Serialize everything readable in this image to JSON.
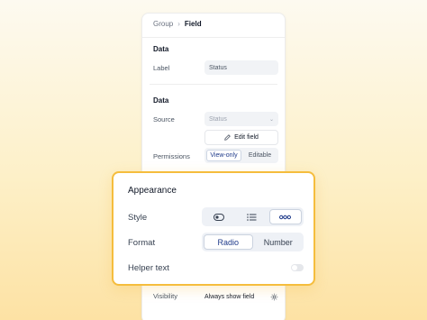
{
  "breadcrumb": {
    "parent": "Group",
    "separator": "›",
    "current": "Field"
  },
  "data_section_1": {
    "title": "Data",
    "label_label": "Label",
    "label_value": "Status"
  },
  "data_section_2": {
    "title": "Data",
    "source_label": "Source",
    "source_value": "Status",
    "edit_button": "Edit field",
    "permissions_label": "Permissions",
    "permissions_options": [
      "View-only",
      "Editable"
    ],
    "permissions_selected": "View-only"
  },
  "visibility": {
    "label": "Visibility",
    "value": "Always show field"
  },
  "appearance": {
    "title": "Appearance",
    "style_label": "Style",
    "style_options": [
      "toggle-icon",
      "list-icon",
      "inline-dots-icon"
    ],
    "style_selected": "inline-dots-icon",
    "format_label": "Format",
    "format_options": [
      "Radio",
      "Number"
    ],
    "format_selected": "Radio",
    "helper_label": "Helper text",
    "helper_enabled": false
  },
  "colors": {
    "accent_border": "#f5bd3d",
    "active_text": "#1e3a8a"
  }
}
